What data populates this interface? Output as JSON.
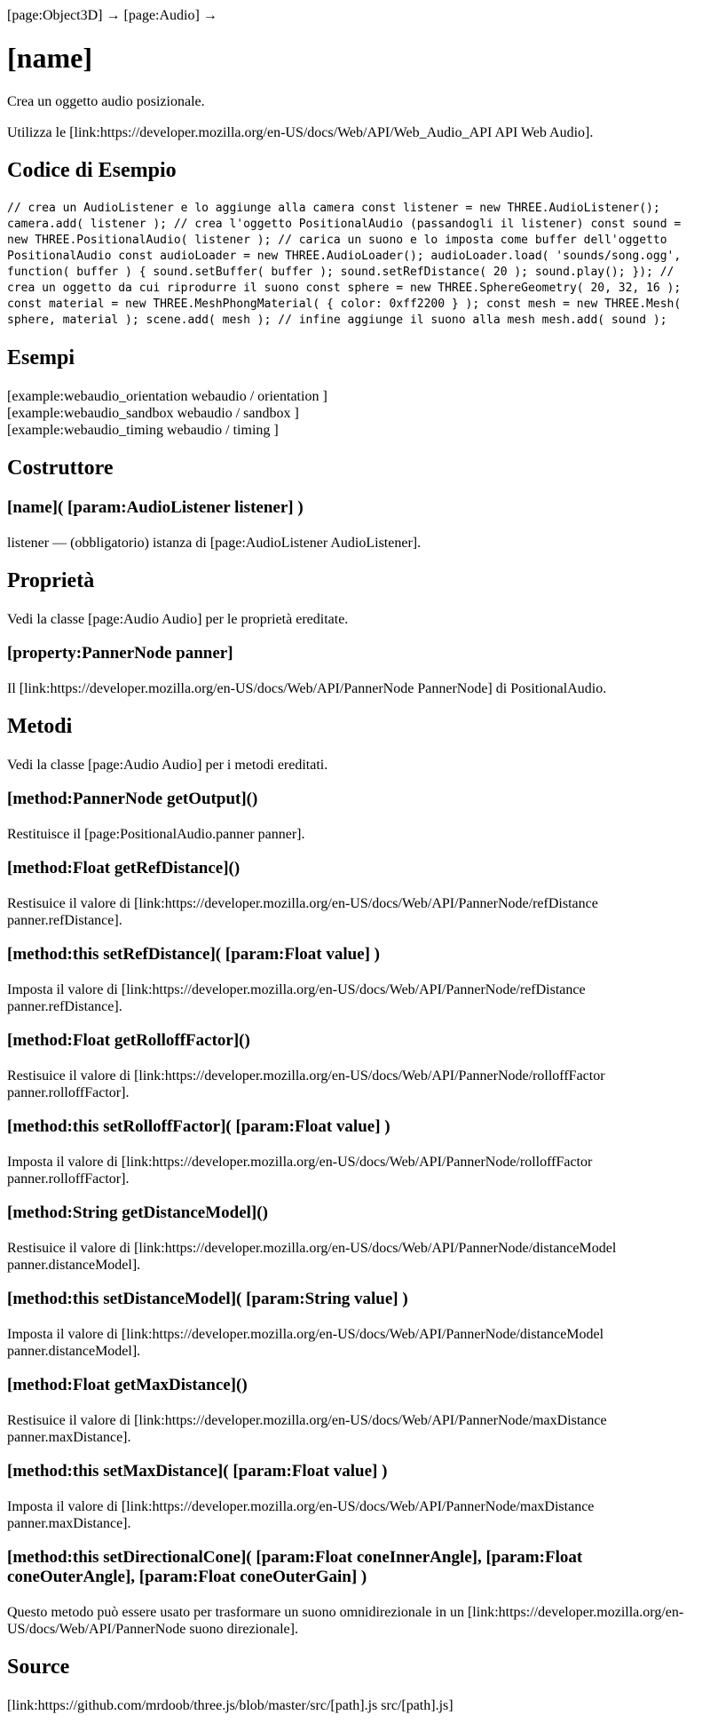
{
  "breadcrumb": "[page:Object3D] → [page:Audio] →",
  "page_title": "[name]",
  "description": "Crea un oggetto audio posizionale.",
  "usage": "Utilizza le [link:https://developer.mozilla.org/en-US/docs/Web/API/Web_Audio_API API Web Audio].",
  "sections": {
    "code_example": "Codice di Esempio",
    "examples": "Esempi",
    "constructor": "Costruttore",
    "properties": "Proprietà",
    "methods": "Metodi",
    "source": "Source"
  },
  "code": "// crea un AudioListener e lo aggiunge alla camera const listener = new THREE.AudioListener(); camera.add( listener ); // crea l'oggetto PositionalAudio (passandogli il listener) const sound = new THREE.PositionalAudio( listener ); // carica un suono e lo imposta come buffer dell'oggetto PositionalAudio const audioLoader = new THREE.AudioLoader(); audioLoader.load( 'sounds/song.ogg', function( buffer ) { sound.setBuffer( buffer ); sound.setRefDistance( 20 ); sound.play(); }); // crea un oggetto da cui riprodurre il suono const sphere = new THREE.SphereGeometry( 20, 32, 16 ); const material = new THREE.MeshPhongMaterial( { color: 0xff2200 } ); const mesh = new THREE.Mesh( sphere, material ); scene.add( mesh ); // infine aggiunge il suono alla mesh mesh.add( sound );",
  "examples": [
    "[example:webaudio_orientation webaudio / orientation ]",
    "[example:webaudio_sandbox webaudio / sandbox ]",
    "[example:webaudio_timing webaudio / timing ]"
  ],
  "constructor": {
    "signature": "[name]( [param:AudioListener listener] )",
    "description": "listener — (obbligatorio) istanza di [page:AudioListener AudioListener]."
  },
  "properties": {
    "intro": "Vedi la classe [page:Audio Audio] per le proprietà ereditate.",
    "items": [
      {
        "signature": "[property:PannerNode panner]",
        "description": "Il [link:https://developer.mozilla.org/en-US/docs/Web/API/PannerNode PannerNode] di PositionalAudio."
      }
    ]
  },
  "methods": {
    "intro": "Vedi la classe [page:Audio Audio] per i metodi ereditati.",
    "items": [
      {
        "signature": "[method:PannerNode getOutput]()",
        "description": "Restituisce il [page:PositionalAudio.panner panner]."
      },
      {
        "signature": "[method:Float getRefDistance]()",
        "description": "Restisuice il valore di [link:https://developer.mozilla.org/en-US/docs/Web/API/PannerNode/refDistance panner.refDistance]."
      },
      {
        "signature": "[method:this setRefDistance]( [param:Float value] )",
        "description": "Imposta il valore di [link:https://developer.mozilla.org/en-US/docs/Web/API/PannerNode/refDistance panner.refDistance]."
      },
      {
        "signature": "[method:Float getRolloffFactor]()",
        "description": "Restisuice il valore di [link:https://developer.mozilla.org/en-US/docs/Web/API/PannerNode/rolloffFactor panner.rolloffFactor]."
      },
      {
        "signature": "[method:this setRolloffFactor]( [param:Float value] )",
        "description": "Imposta il valore di [link:https://developer.mozilla.org/en-US/docs/Web/API/PannerNode/rolloffFactor panner.rolloffFactor]."
      },
      {
        "signature": "[method:String getDistanceModel]()",
        "description": "Restisuice il valore di [link:https://developer.mozilla.org/en-US/docs/Web/API/PannerNode/distanceModel panner.distanceModel]."
      },
      {
        "signature": "[method:this setDistanceModel]( [param:String value] )",
        "description": "Imposta il valore di [link:https://developer.mozilla.org/en-US/docs/Web/API/PannerNode/distanceModel panner.distanceModel]."
      },
      {
        "signature": "[method:Float getMaxDistance]()",
        "description": "Restisuice il valore di [link:https://developer.mozilla.org/en-US/docs/Web/API/PannerNode/maxDistance panner.maxDistance]."
      },
      {
        "signature": "[method:this setMaxDistance]( [param:Float value] )",
        "description": "Imposta il valore di [link:https://developer.mozilla.org/en-US/docs/Web/API/PannerNode/maxDistance panner.maxDistance]."
      },
      {
        "signature": "[method:this setDirectionalCone]( [param:Float coneInnerAngle], [param:Float coneOuterAngle], [param:Float coneOuterGain] )",
        "description": "Questo metodo può essere usato per trasformare un suono omnidirezionale in un [link:https://developer.mozilla.org/en-US/docs/Web/API/PannerNode suono direzionale]."
      }
    ]
  },
  "source": "[link:https://github.com/mrdoob/three.js/blob/master/src/[path].js src/[path].js]"
}
